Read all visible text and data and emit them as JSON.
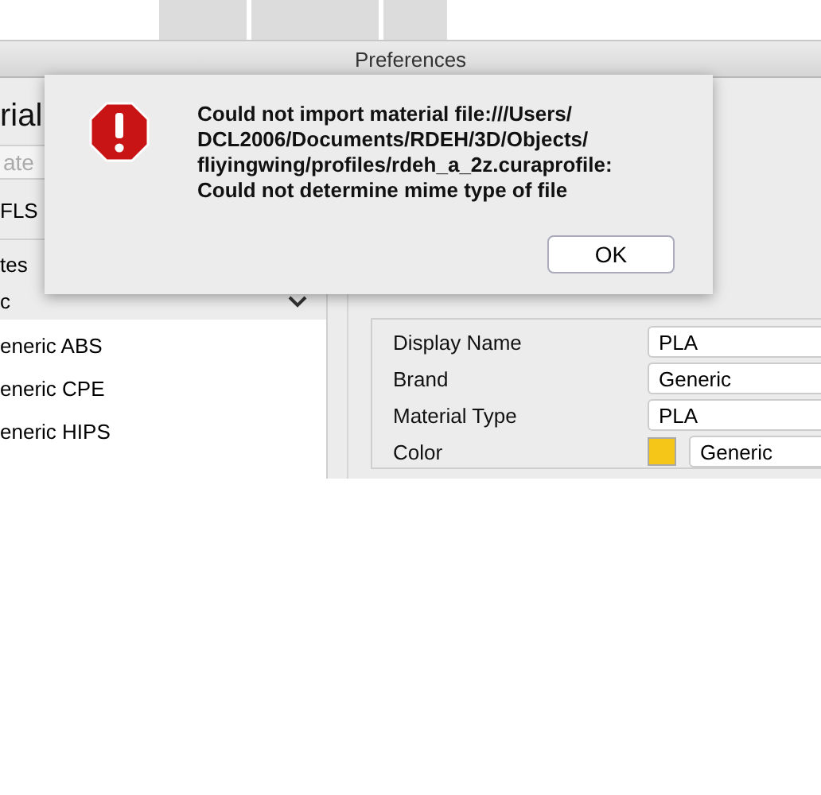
{
  "window": {
    "title": "Preferences"
  },
  "sidebar": {
    "heading": "rial",
    "search": {
      "placeholder": "ate"
    },
    "printer": "FLS",
    "group": "tes",
    "brand": {
      "label": "c",
      "expanded": true
    },
    "items": [
      {
        "label": "eneric ABS",
        "selected": false
      },
      {
        "label": "eneric CPE",
        "selected": false
      },
      {
        "label": "eneric HIPS",
        "selected": false
      }
    ]
  },
  "details": [
    {
      "kind": "text",
      "label": "Display Name",
      "value": "PLA"
    },
    {
      "kind": "text",
      "label": "Brand",
      "value": "Generic"
    },
    {
      "kind": "text",
      "label": "Material Type",
      "value": "PLA"
    },
    {
      "kind": "color",
      "label": "Color",
      "value": "Generic",
      "color": "#f5c518"
    }
  ],
  "dialog": {
    "message_lines": [
      "Could not import material file:///Users/",
      "DCL2006/Documents/RDEH/3D/Objects/",
      "fliyingwing/profiles/rdeh_a_2z.curaprofile:",
      "Could not determine mime type of file"
    ],
    "button": "OK"
  }
}
